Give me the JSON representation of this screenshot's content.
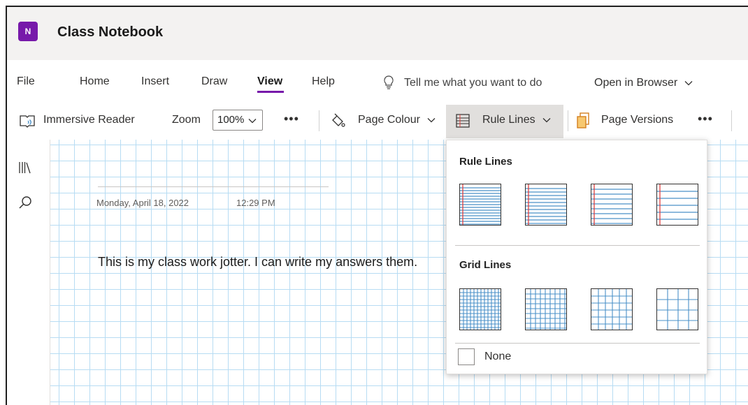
{
  "app": {
    "icon_text": "N",
    "title": "Class Notebook",
    "accent": "#7719aa"
  },
  "tabs": [
    {
      "label": "File"
    },
    {
      "label": "Home"
    },
    {
      "label": "Insert"
    },
    {
      "label": "Draw"
    },
    {
      "label": "View",
      "active": true
    },
    {
      "label": "Help"
    }
  ],
  "search": {
    "placeholder": "Tell me what you want to do",
    "icon": "lightbulb-icon"
  },
  "open_in_browser": {
    "label": "Open in Browser",
    "icon": "chevron-down-icon"
  },
  "toolbar": {
    "immersive_reader": "Immersive Reader",
    "zoom_label": "Zoom",
    "zoom_value": "100%",
    "more": "•••",
    "page_colour": "Page Colour",
    "rule_lines": "Rule Lines",
    "page_versions": "Page Versions"
  },
  "page": {
    "date": "Monday, April 18, 2022",
    "time": "12:29 PM",
    "body": "This is my class work jotter. I can write my answers them."
  },
  "rule_menu": {
    "rule_header": "Rule Lines",
    "grid_header": "Grid Lines",
    "none_label": "None",
    "line_color": "#4a90c8",
    "margin_color": "#e04040"
  }
}
